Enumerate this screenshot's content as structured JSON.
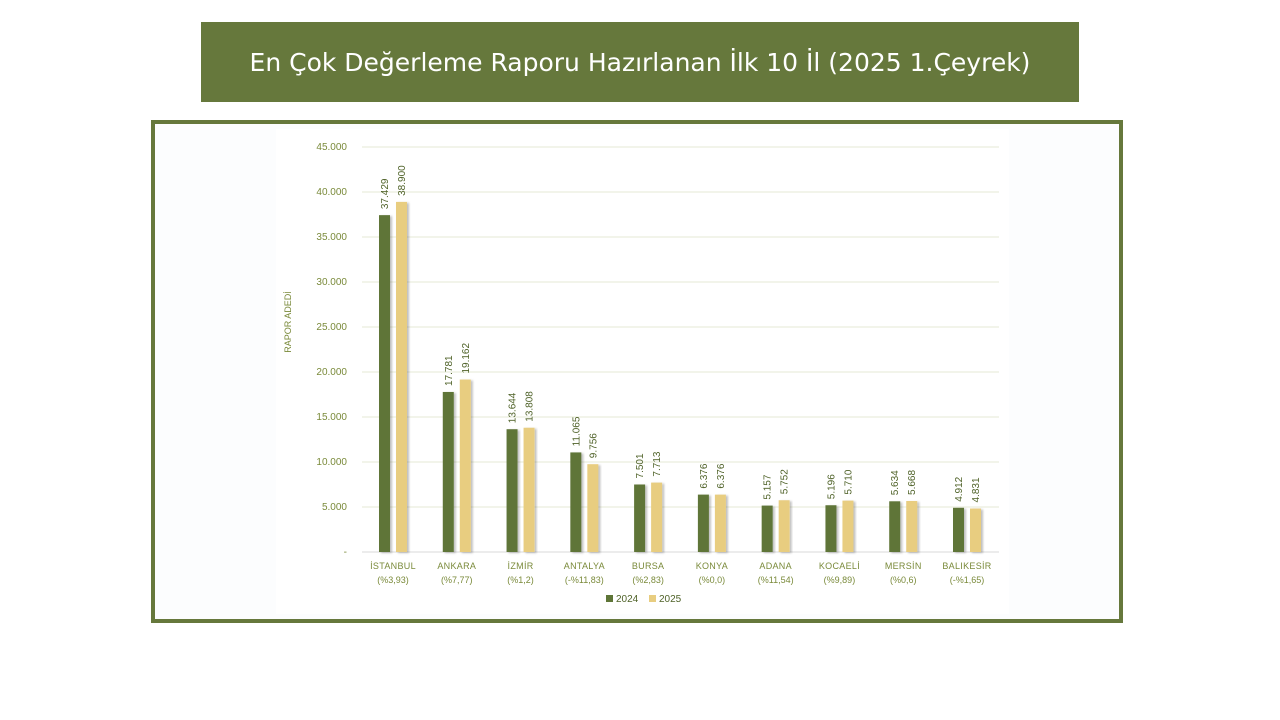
{
  "title": "En Çok Değerleme Raporu Hazırlanan İlk 10 İl (2025 1.Çeyrek)",
  "colors": {
    "banner": "#66783c",
    "series_2024": "#5e7537",
    "series_2025": "#e8cd80",
    "axis_text": "#7a8a3a"
  },
  "chart_data": {
    "type": "bar",
    "ylabel": "RAPOR ADEDİ",
    "ylim": [
      0,
      45000
    ],
    "yticks": [
      "-",
      "5.000",
      "10.000",
      "15.000",
      "20.000",
      "25.000",
      "30.000",
      "35.000",
      "40.000",
      "45.000"
    ],
    "categories": [
      [
        "İSTANBUL",
        "(%3,93)"
      ],
      [
        "ANKARA",
        "(%7,77)"
      ],
      [
        "İZMİR",
        "(%1,2)"
      ],
      [
        "ANTALYA",
        "(-%11,83)"
      ],
      [
        "BURSA",
        "(%2,83)"
      ],
      [
        "KONYA",
        "(%0,0)"
      ],
      [
        "ADANA",
        "(%11,54)"
      ],
      [
        "KOCAELİ",
        "(%9,89)"
      ],
      [
        "MERSİN",
        "(%0,6)"
      ],
      [
        "BALIKESİR",
        "(-%1,65)"
      ]
    ],
    "series": [
      {
        "name": "2024",
        "values": [
          37429,
          17781,
          13644,
          11065,
          7501,
          6376,
          5157,
          5196,
          5634,
          4912
        ],
        "labels": [
          "37.429",
          "17.781",
          "13.644",
          "11.065",
          "7.501",
          "6.376",
          "5.157",
          "5.196",
          "5.634",
          "4.912"
        ]
      },
      {
        "name": "2025",
        "values": [
          38900,
          19162,
          13808,
          9756,
          7713,
          6376,
          5752,
          5710,
          5668,
          4831
        ],
        "labels": [
          "38.900",
          "19.162",
          "13.808",
          "9.756",
          "7.713",
          "6.376",
          "5.752",
          "5.710",
          "5.668",
          "4.831"
        ]
      }
    ],
    "legend_position": "bottom-center",
    "grid": true
  }
}
